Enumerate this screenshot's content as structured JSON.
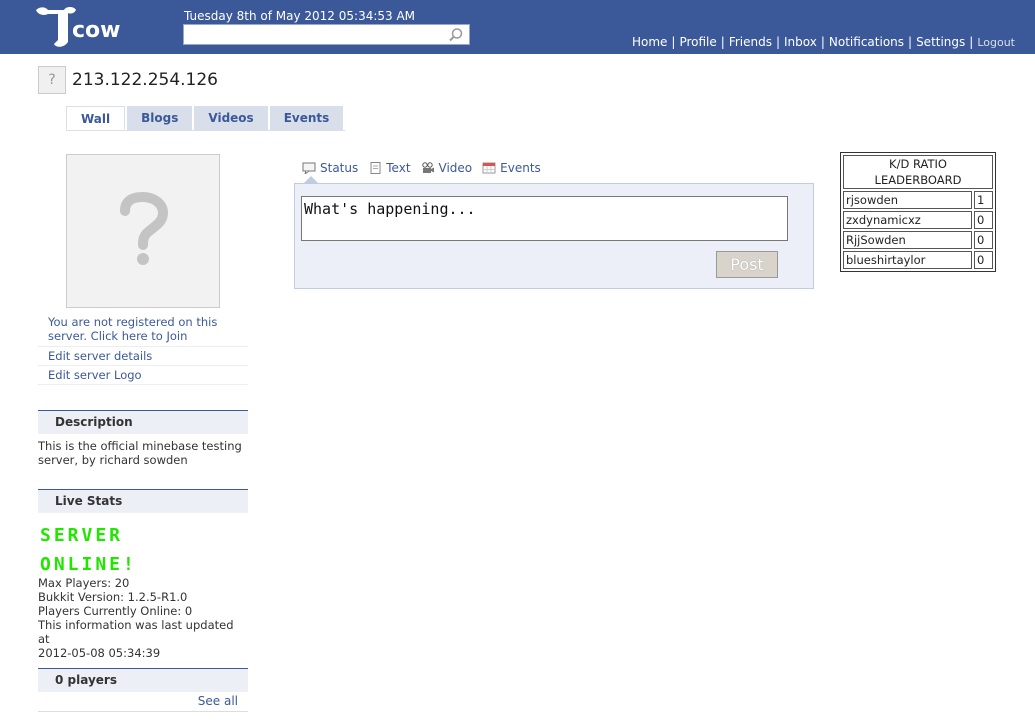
{
  "header": {
    "logo_text": "cow",
    "date": "Tuesday 8th of May 2012 05:34:53 AM",
    "search": {
      "value": "",
      "placeholder": ""
    },
    "nav": [
      "Home",
      "Profile",
      "Friends",
      "Inbox",
      "Notifications",
      "Settings"
    ],
    "logout": "Logout",
    "bar_color": "#3b5998"
  },
  "profile": {
    "avatar_glyph": "?",
    "name": "213.122.254.126"
  },
  "tabs": [
    {
      "label": "Wall",
      "active": true
    },
    {
      "label": "Blogs",
      "active": false
    },
    {
      "label": "Videos",
      "active": false
    },
    {
      "label": "Events",
      "active": false
    }
  ],
  "sidebar": {
    "register_link": "You are not registered on this server. Click here to Join",
    "edit_details": "Edit server details",
    "edit_logo": "Edit server Logo",
    "description": {
      "title": "Description",
      "text": "This is the official minebase testing server, by richard sowden"
    },
    "live_stats": {
      "title": "Live Stats",
      "status_line1": "SERVER",
      "status_line2": "ONLINE!",
      "status_color": "#22e600",
      "max_players": "Max Players: 20",
      "bukkit_version": "Bukkit Version: 1.2.5-R1.0",
      "players_online": "Players Currently Online: 0",
      "updated_line1": "This information was last updated at",
      "updated_line2": "2012-05-08 05:34:39"
    },
    "players": {
      "title": "0 players",
      "see_all": "See all"
    }
  },
  "composer": {
    "types": [
      {
        "label": "Status",
        "icon": "status-icon"
      },
      {
        "label": "Text",
        "icon": "text-icon"
      },
      {
        "label": "Video",
        "icon": "video-icon"
      },
      {
        "label": "Events",
        "icon": "calendar-icon"
      }
    ],
    "textarea_value": "What's happening...",
    "post_label": "Post"
  },
  "leaderboard": {
    "title": "K/D RATIO LEADERBOARD",
    "rows": [
      {
        "name": "rjsowden",
        "value": "1"
      },
      {
        "name": "zxdynamicxz",
        "value": "0"
      },
      {
        "name": "RjjSowden",
        "value": "0"
      },
      {
        "name": "blueshirtaylor",
        "value": "0"
      }
    ]
  }
}
